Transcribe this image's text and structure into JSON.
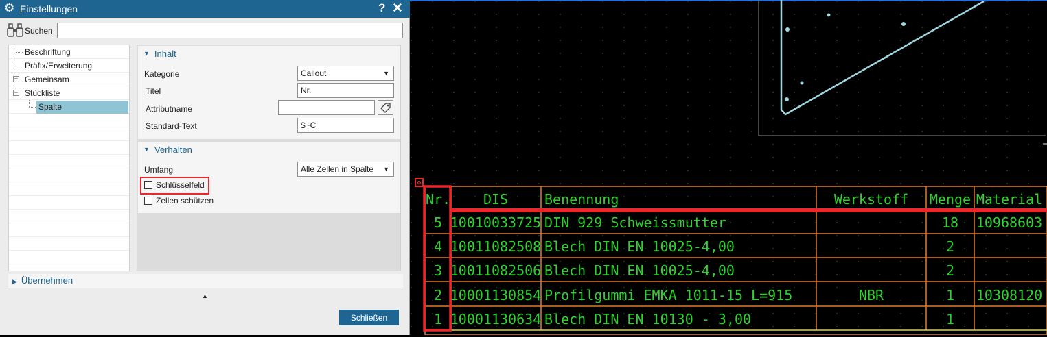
{
  "dialog": {
    "title": "Einstellungen",
    "help_glyph": "?",
    "close_glyph": "✕",
    "search_label": "Suchen",
    "search_value": "",
    "tree": [
      {
        "label": "Beschriftung"
      },
      {
        "label": "Präfix/Erweiterung"
      },
      {
        "label": "Gemeinsam",
        "expander": "+"
      },
      {
        "label": "Stückliste",
        "expander": "−"
      },
      {
        "label": "Spalte",
        "selected": true
      }
    ],
    "inhalt": {
      "header": "Inhalt",
      "kategorie_label": "Kategorie",
      "kategorie_value": "Callout",
      "titel_label": "Titel",
      "titel_value": "Nr.",
      "attributname_label": "Attributname",
      "attributname_value": "",
      "standard_text_label": "Standard-Text",
      "standard_text_value": "$~C"
    },
    "verhalten": {
      "header": "Verhalten",
      "umfang_label": "Umfang",
      "umfang_value": "Alle Zellen in Spalte",
      "schluesselfeld_label": "Schlüsselfeld",
      "schluesselfeld_checked": false,
      "zellen_schuetzen_label": "Zellen schützen",
      "zellen_schuetzen_checked": false
    },
    "apply_label": "Übernehmen",
    "close_button": "Schließen"
  },
  "table": {
    "headers": [
      "Nr.",
      "DIS",
      "Benennung",
      "Werkstoff",
      "Menge",
      "Material"
    ],
    "rows": [
      [
        "5",
        "10010033725",
        "DIN 929 Schweissmutter",
        "",
        "18",
        "10968603"
      ],
      [
        "4",
        "10011082508",
        "Blech DIN EN 10025-4,00",
        "",
        "2",
        ""
      ],
      [
        "3",
        "10011082506",
        "Blech DIN EN 10025-4,00",
        "",
        "2",
        ""
      ],
      [
        "2",
        "10001130854",
        "Profilgummi EMKA 1011-15 L=915",
        "NBR",
        "1",
        "10308120"
      ],
      [
        "1",
        "10001130634",
        "Blech DIN EN 10130 - 3,00",
        "",
        "1",
        ""
      ]
    ]
  },
  "colors": {
    "title_bar": "#1e6591",
    "accent_blue": "#1e6591",
    "selection": "#8fc4d4",
    "highlight_red": "#e8282c",
    "cad_background": "#000000",
    "table_text": "#2fd12f",
    "table_grid": "#e07a2a",
    "geometry": "#9fd8e0"
  }
}
